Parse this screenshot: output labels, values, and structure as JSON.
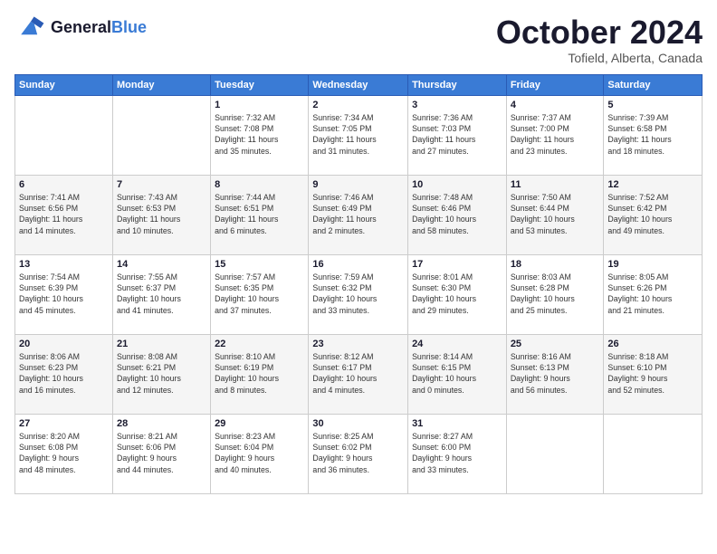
{
  "header": {
    "logo_line1": "General",
    "logo_line2": "Blue",
    "month": "October 2024",
    "location": "Tofield, Alberta, Canada"
  },
  "days_of_week": [
    "Sunday",
    "Monday",
    "Tuesday",
    "Wednesday",
    "Thursday",
    "Friday",
    "Saturday"
  ],
  "weeks": [
    [
      {
        "day": "",
        "detail": ""
      },
      {
        "day": "",
        "detail": ""
      },
      {
        "day": "1",
        "detail": "Sunrise: 7:32 AM\nSunset: 7:08 PM\nDaylight: 11 hours\nand 35 minutes."
      },
      {
        "day": "2",
        "detail": "Sunrise: 7:34 AM\nSunset: 7:05 PM\nDaylight: 11 hours\nand 31 minutes."
      },
      {
        "day": "3",
        "detail": "Sunrise: 7:36 AM\nSunset: 7:03 PM\nDaylight: 11 hours\nand 27 minutes."
      },
      {
        "day": "4",
        "detail": "Sunrise: 7:37 AM\nSunset: 7:00 PM\nDaylight: 11 hours\nand 23 minutes."
      },
      {
        "day": "5",
        "detail": "Sunrise: 7:39 AM\nSunset: 6:58 PM\nDaylight: 11 hours\nand 18 minutes."
      }
    ],
    [
      {
        "day": "6",
        "detail": "Sunrise: 7:41 AM\nSunset: 6:56 PM\nDaylight: 11 hours\nand 14 minutes."
      },
      {
        "day": "7",
        "detail": "Sunrise: 7:43 AM\nSunset: 6:53 PM\nDaylight: 11 hours\nand 10 minutes."
      },
      {
        "day": "8",
        "detail": "Sunrise: 7:44 AM\nSunset: 6:51 PM\nDaylight: 11 hours\nand 6 minutes."
      },
      {
        "day": "9",
        "detail": "Sunrise: 7:46 AM\nSunset: 6:49 PM\nDaylight: 11 hours\nand 2 minutes."
      },
      {
        "day": "10",
        "detail": "Sunrise: 7:48 AM\nSunset: 6:46 PM\nDaylight: 10 hours\nand 58 minutes."
      },
      {
        "day": "11",
        "detail": "Sunrise: 7:50 AM\nSunset: 6:44 PM\nDaylight: 10 hours\nand 53 minutes."
      },
      {
        "day": "12",
        "detail": "Sunrise: 7:52 AM\nSunset: 6:42 PM\nDaylight: 10 hours\nand 49 minutes."
      }
    ],
    [
      {
        "day": "13",
        "detail": "Sunrise: 7:54 AM\nSunset: 6:39 PM\nDaylight: 10 hours\nand 45 minutes."
      },
      {
        "day": "14",
        "detail": "Sunrise: 7:55 AM\nSunset: 6:37 PM\nDaylight: 10 hours\nand 41 minutes."
      },
      {
        "day": "15",
        "detail": "Sunrise: 7:57 AM\nSunset: 6:35 PM\nDaylight: 10 hours\nand 37 minutes."
      },
      {
        "day": "16",
        "detail": "Sunrise: 7:59 AM\nSunset: 6:32 PM\nDaylight: 10 hours\nand 33 minutes."
      },
      {
        "day": "17",
        "detail": "Sunrise: 8:01 AM\nSunset: 6:30 PM\nDaylight: 10 hours\nand 29 minutes."
      },
      {
        "day": "18",
        "detail": "Sunrise: 8:03 AM\nSunset: 6:28 PM\nDaylight: 10 hours\nand 25 minutes."
      },
      {
        "day": "19",
        "detail": "Sunrise: 8:05 AM\nSunset: 6:26 PM\nDaylight: 10 hours\nand 21 minutes."
      }
    ],
    [
      {
        "day": "20",
        "detail": "Sunrise: 8:06 AM\nSunset: 6:23 PM\nDaylight: 10 hours\nand 16 minutes."
      },
      {
        "day": "21",
        "detail": "Sunrise: 8:08 AM\nSunset: 6:21 PM\nDaylight: 10 hours\nand 12 minutes."
      },
      {
        "day": "22",
        "detail": "Sunrise: 8:10 AM\nSunset: 6:19 PM\nDaylight: 10 hours\nand 8 minutes."
      },
      {
        "day": "23",
        "detail": "Sunrise: 8:12 AM\nSunset: 6:17 PM\nDaylight: 10 hours\nand 4 minutes."
      },
      {
        "day": "24",
        "detail": "Sunrise: 8:14 AM\nSunset: 6:15 PM\nDaylight: 10 hours\nand 0 minutes."
      },
      {
        "day": "25",
        "detail": "Sunrise: 8:16 AM\nSunset: 6:13 PM\nDaylight: 9 hours\nand 56 minutes."
      },
      {
        "day": "26",
        "detail": "Sunrise: 8:18 AM\nSunset: 6:10 PM\nDaylight: 9 hours\nand 52 minutes."
      }
    ],
    [
      {
        "day": "27",
        "detail": "Sunrise: 8:20 AM\nSunset: 6:08 PM\nDaylight: 9 hours\nand 48 minutes."
      },
      {
        "day": "28",
        "detail": "Sunrise: 8:21 AM\nSunset: 6:06 PM\nDaylight: 9 hours\nand 44 minutes."
      },
      {
        "day": "29",
        "detail": "Sunrise: 8:23 AM\nSunset: 6:04 PM\nDaylight: 9 hours\nand 40 minutes."
      },
      {
        "day": "30",
        "detail": "Sunrise: 8:25 AM\nSunset: 6:02 PM\nDaylight: 9 hours\nand 36 minutes."
      },
      {
        "day": "31",
        "detail": "Sunrise: 8:27 AM\nSunset: 6:00 PM\nDaylight: 9 hours\nand 33 minutes."
      },
      {
        "day": "",
        "detail": ""
      },
      {
        "day": "",
        "detail": ""
      }
    ]
  ]
}
